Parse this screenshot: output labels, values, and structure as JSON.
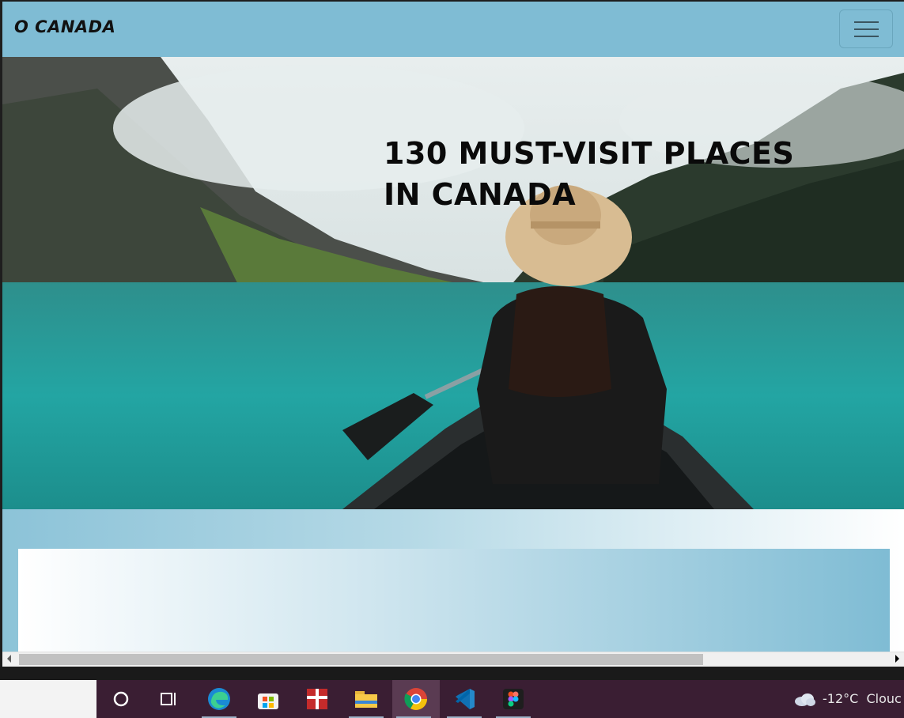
{
  "navbar": {
    "brand": "O CANADA",
    "toggler_icon": "hamburger-icon"
  },
  "hero": {
    "title": "130 MUST-VISIT PLACES IN CANADA"
  },
  "taskbar": {
    "apps": [
      "cortana-icon",
      "task-view-icon",
      "edge-icon",
      "store-icon",
      "gift-icon",
      "file-explorer-icon",
      "chrome-icon",
      "vscode-icon",
      "figma-icon"
    ],
    "weather_temp": "-12°C",
    "weather_text": "Clouc"
  },
  "colors": {
    "navbar": "#7fbcd4",
    "taskbar": "#3a1e33"
  }
}
